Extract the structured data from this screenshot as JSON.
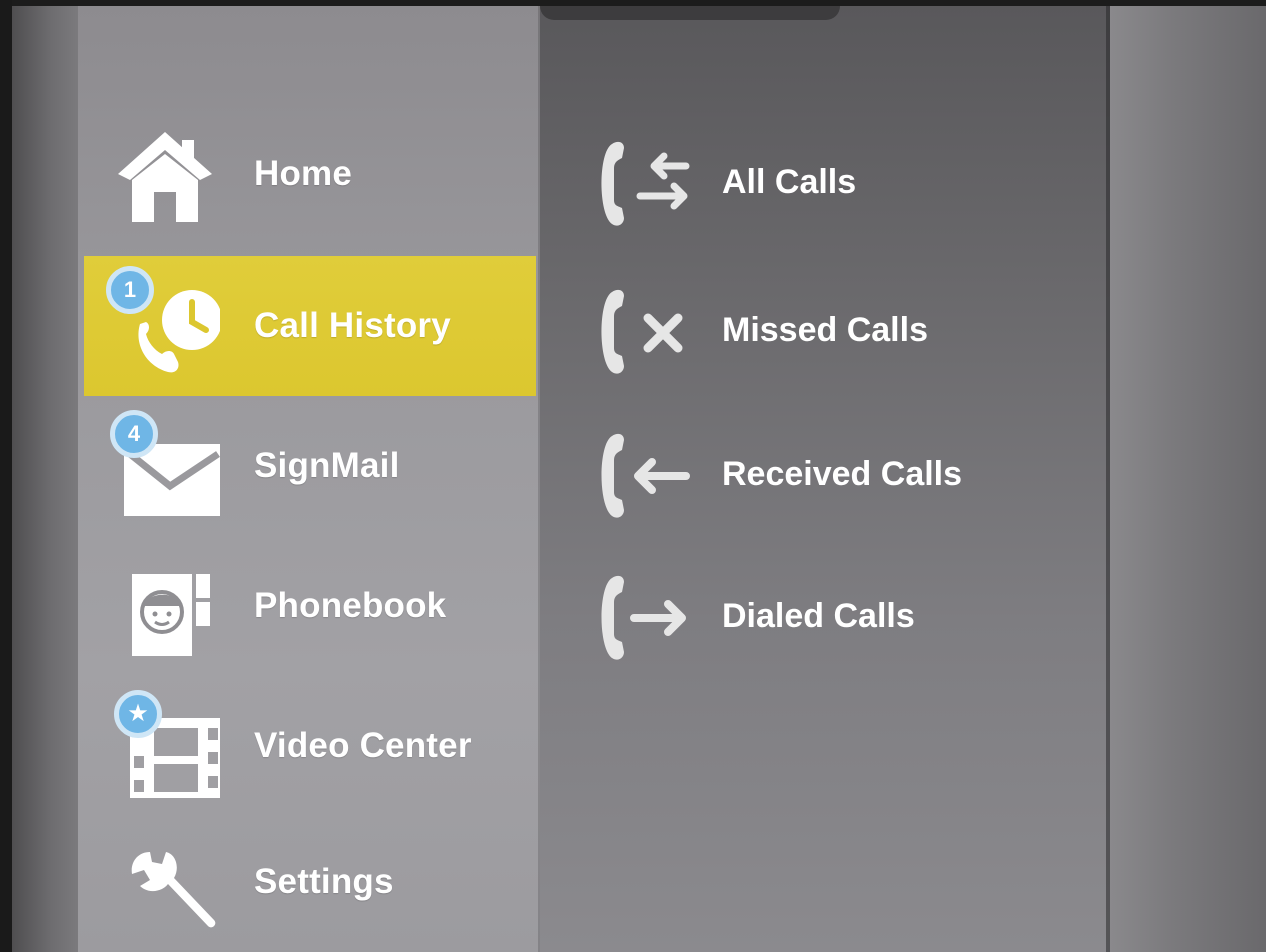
{
  "sidebar": {
    "items": [
      {
        "label": "Home",
        "icon": "home-icon",
        "selected": false
      },
      {
        "label": "Call History",
        "icon": "call-history-icon",
        "badge": "1",
        "selected": true
      },
      {
        "label": "SignMail",
        "icon": "signmail-icon",
        "badge": "4",
        "selected": false
      },
      {
        "label": "Phonebook",
        "icon": "phonebook-icon",
        "selected": false
      },
      {
        "label": "Video Center",
        "icon": "video-center-icon",
        "selected": false
      },
      {
        "label": "Settings",
        "icon": "settings-icon",
        "selected": false
      }
    ]
  },
  "submenu": {
    "items": [
      {
        "label": "All Calls",
        "icon": "all-calls-icon"
      },
      {
        "label": "Missed Calls",
        "icon": "missed-calls-icon"
      },
      {
        "label": "Received Calls",
        "icon": "received-calls-icon"
      },
      {
        "label": "Dialed Calls",
        "icon": "dialed-calls-icon"
      }
    ]
  },
  "colors": {
    "selected_highlight": "#dcc72f",
    "badge_blue": "#6fb6e6",
    "icon_white": "#ffffff",
    "submenu_icon": "#e6e6e6"
  }
}
